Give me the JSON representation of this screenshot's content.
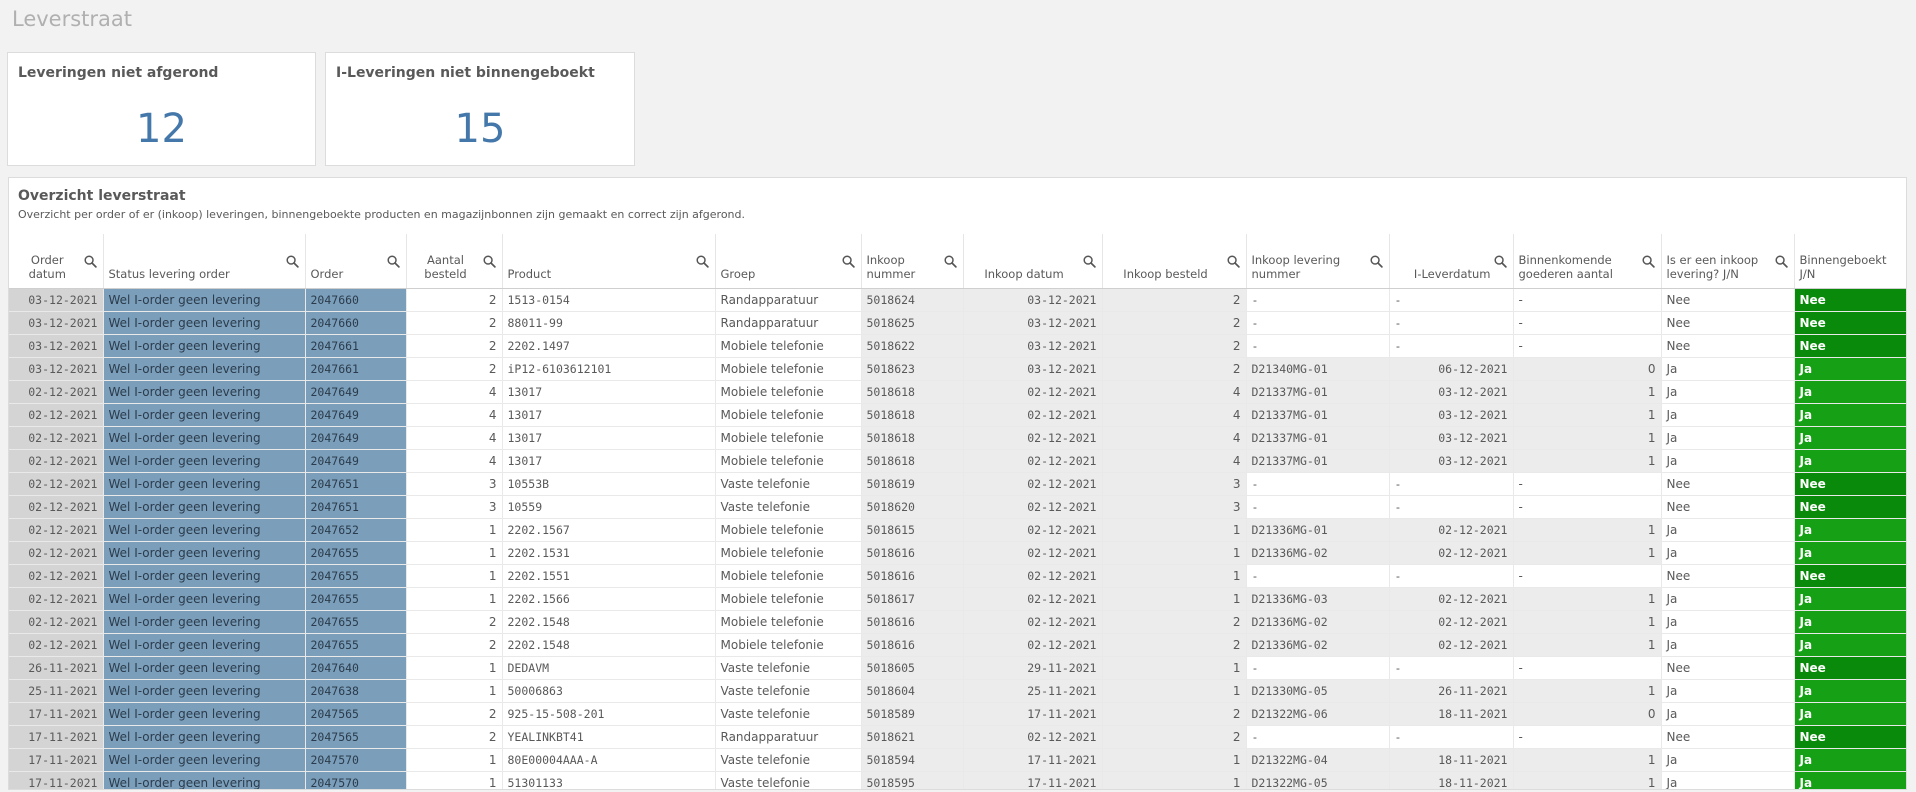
{
  "page": {
    "title": "Leverstraat"
  },
  "kpis": [
    {
      "title": "Leveringen niet afgerond",
      "value": "12"
    },
    {
      "title": "I-Leveringen niet binnengeboekt",
      "value": "15"
    }
  ],
  "panel": {
    "title": "Overzicht leverstraat",
    "subtitle": "Overzicht per order of er (inkoop) leveringen, binnengeboekte producten en magazijnbonnen zijn gemaakt en correct zijn afgerond."
  },
  "colors": {
    "status_bg": "#7b9fbb",
    "date_bg": "#d4d4d4",
    "grey_bg": "#ececec",
    "green_dark": "#0a8a0a",
    "green_light": "#15a015",
    "kpi_value": "#4477aa"
  },
  "table": {
    "columns": [
      {
        "key": "order_datum",
        "label": "Order datum",
        "search": true,
        "align": "c"
      },
      {
        "key": "status",
        "label": "Status levering order",
        "search": true,
        "align": "l"
      },
      {
        "key": "order",
        "label": "Order",
        "search": true,
        "align": "l"
      },
      {
        "key": "aantal",
        "label": "Aantal besteld",
        "search": true,
        "align": "c"
      },
      {
        "key": "product",
        "label": "Product",
        "search": true,
        "align": "l"
      },
      {
        "key": "groep",
        "label": "Groep",
        "search": true,
        "align": "l"
      },
      {
        "key": "inkoop_nummer",
        "label": "Inkoop nummer",
        "search": true,
        "align": "l"
      },
      {
        "key": "inkoop_datum",
        "label": "Inkoop datum",
        "search": true,
        "align": "c"
      },
      {
        "key": "inkoop_besteld",
        "label": "Inkoop besteld",
        "search": true,
        "align": "c"
      },
      {
        "key": "levering_nummer",
        "label": "Inkoop levering nummer",
        "search": true,
        "align": "l"
      },
      {
        "key": "leverdatum",
        "label": "I-Leverdatum",
        "search": true,
        "align": "r"
      },
      {
        "key": "binnenkomende",
        "label": "Binnenkomende goederen aantal",
        "search": true,
        "align": "l"
      },
      {
        "key": "is_levering",
        "label": "Is er een inkoop levering? J/N",
        "search": true,
        "align": "l"
      },
      {
        "key": "binnengeboekt",
        "label": "Binnengeboekt J/N",
        "search": false,
        "align": "l"
      }
    ],
    "rows": [
      [
        "03-12-2021",
        "Wel I-order geen levering",
        "2047660",
        "2",
        "1513-0154",
        "Randapparatuur",
        "5018624",
        "03-12-2021",
        "2",
        "-",
        "-",
        "-",
        "Nee",
        "Nee"
      ],
      [
        "03-12-2021",
        "Wel I-order geen levering",
        "2047660",
        "2",
        "88011-99",
        "Randapparatuur",
        "5018625",
        "03-12-2021",
        "2",
        "-",
        "-",
        "-",
        "Nee",
        "Nee"
      ],
      [
        "03-12-2021",
        "Wel I-order geen levering",
        "2047661",
        "2",
        "2202.1497",
        "Mobiele telefonie",
        "5018622",
        "03-12-2021",
        "2",
        "-",
        "-",
        "-",
        "Nee",
        "Nee"
      ],
      [
        "03-12-2021",
        "Wel I-order geen levering",
        "2047661",
        "2",
        "iP12-6103612101",
        "Mobiele telefonie",
        "5018623",
        "03-12-2021",
        "2",
        "D21340MG-01",
        "06-12-2021",
        "0",
        "Ja",
        "Ja"
      ],
      [
        "02-12-2021",
        "Wel I-order geen levering",
        "2047649",
        "4",
        "13017",
        "Mobiele telefonie",
        "5018618",
        "02-12-2021",
        "4",
        "D21337MG-01",
        "03-12-2021",
        "1",
        "Ja",
        "Ja"
      ],
      [
        "02-12-2021",
        "Wel I-order geen levering",
        "2047649",
        "4",
        "13017",
        "Mobiele telefonie",
        "5018618",
        "02-12-2021",
        "4",
        "D21337MG-01",
        "03-12-2021",
        "1",
        "Ja",
        "Ja"
      ],
      [
        "02-12-2021",
        "Wel I-order geen levering",
        "2047649",
        "4",
        "13017",
        "Mobiele telefonie",
        "5018618",
        "02-12-2021",
        "4",
        "D21337MG-01",
        "03-12-2021",
        "1",
        "Ja",
        "Ja"
      ],
      [
        "02-12-2021",
        "Wel I-order geen levering",
        "2047649",
        "4",
        "13017",
        "Mobiele telefonie",
        "5018618",
        "02-12-2021",
        "4",
        "D21337MG-01",
        "03-12-2021",
        "1",
        "Ja",
        "Ja"
      ],
      [
        "02-12-2021",
        "Wel I-order geen levering",
        "2047651",
        "3",
        "10553B",
        "Vaste telefonie",
        "5018619",
        "02-12-2021",
        "3",
        "-",
        "-",
        "-",
        "Nee",
        "Nee"
      ],
      [
        "02-12-2021",
        "Wel I-order geen levering",
        "2047651",
        "3",
        "10559",
        "Vaste telefonie",
        "5018620",
        "02-12-2021",
        "3",
        "-",
        "-",
        "-",
        "Nee",
        "Nee"
      ],
      [
        "02-12-2021",
        "Wel I-order geen levering",
        "2047652",
        "1",
        "2202.1567",
        "Mobiele telefonie",
        "5018615",
        "02-12-2021",
        "1",
        "D21336MG-01",
        "02-12-2021",
        "1",
        "Ja",
        "Ja"
      ],
      [
        "02-12-2021",
        "Wel I-order geen levering",
        "2047655",
        "1",
        "2202.1531",
        "Mobiele telefonie",
        "5018616",
        "02-12-2021",
        "1",
        "D21336MG-02",
        "02-12-2021",
        "1",
        "Ja",
        "Ja"
      ],
      [
        "02-12-2021",
        "Wel I-order geen levering",
        "2047655",
        "1",
        "2202.1551",
        "Mobiele telefonie",
        "5018616",
        "02-12-2021",
        "1",
        "-",
        "-",
        "-",
        "Nee",
        "Nee"
      ],
      [
        "02-12-2021",
        "Wel I-order geen levering",
        "2047655",
        "1",
        "2202.1566",
        "Mobiele telefonie",
        "5018617",
        "02-12-2021",
        "1",
        "D21336MG-03",
        "02-12-2021",
        "1",
        "Ja",
        "Ja"
      ],
      [
        "02-12-2021",
        "Wel I-order geen levering",
        "2047655",
        "2",
        "2202.1548",
        "Mobiele telefonie",
        "5018616",
        "02-12-2021",
        "2",
        "D21336MG-02",
        "02-12-2021",
        "1",
        "Ja",
        "Ja"
      ],
      [
        "02-12-2021",
        "Wel I-order geen levering",
        "2047655",
        "2",
        "2202.1548",
        "Mobiele telefonie",
        "5018616",
        "02-12-2021",
        "2",
        "D21336MG-02",
        "02-12-2021",
        "1",
        "Ja",
        "Ja"
      ],
      [
        "26-11-2021",
        "Wel I-order geen levering",
        "2047640",
        "1",
        "DEDAVM",
        "Vaste telefonie",
        "5018605",
        "29-11-2021",
        "1",
        "-",
        "-",
        "-",
        "Nee",
        "Nee"
      ],
      [
        "25-11-2021",
        "Wel I-order geen levering",
        "2047638",
        "1",
        "50006863",
        "Vaste telefonie",
        "5018604",
        "25-11-2021",
        "1",
        "D21330MG-05",
        "26-11-2021",
        "1",
        "Ja",
        "Ja"
      ],
      [
        "17-11-2021",
        "Wel I-order geen levering",
        "2047565",
        "2",
        "925-15-508-201",
        "Vaste telefonie",
        "5018589",
        "17-11-2021",
        "2",
        "D21322MG-06",
        "18-11-2021",
        "0",
        "Ja",
        "Ja"
      ],
      [
        "17-11-2021",
        "Wel I-order geen levering",
        "2047565",
        "2",
        "YEALINKBT41",
        "Randapparatuur",
        "5018621",
        "02-12-2021",
        "2",
        "-",
        "-",
        "-",
        "Nee",
        "Nee"
      ],
      [
        "17-11-2021",
        "Wel I-order geen levering",
        "2047570",
        "1",
        "80E00004AAA-A",
        "Vaste telefonie",
        "5018594",
        "17-11-2021",
        "1",
        "D21322MG-04",
        "18-11-2021",
        "1",
        "Ja",
        "Ja"
      ],
      [
        "17-11-2021",
        "Wel I-order geen levering",
        "2047570",
        "1",
        "51301133",
        "Vaste telefonie",
        "5018595",
        "17-11-2021",
        "1",
        "D21322MG-05",
        "18-11-2021",
        "1",
        "Ja",
        "Ja"
      ]
    ]
  }
}
